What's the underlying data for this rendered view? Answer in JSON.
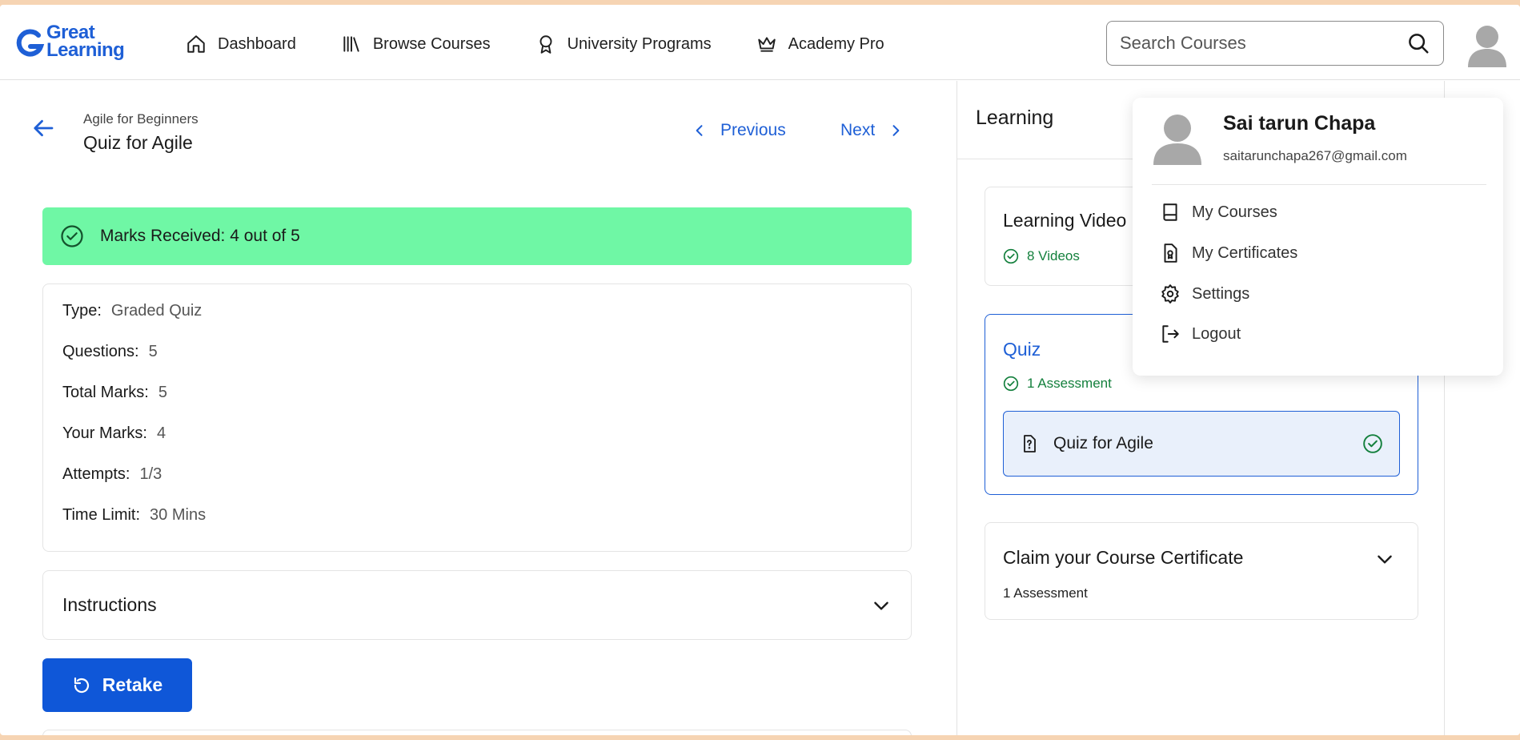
{
  "brand": {
    "line1": "Great",
    "line2": "Learning",
    "color": "#1e5fd6"
  },
  "nav": [
    {
      "label": "Dashboard",
      "icon": "home-icon"
    },
    {
      "label": "Browse Courses",
      "icon": "library-icon"
    },
    {
      "label": "University Programs",
      "icon": "award-icon"
    },
    {
      "label": "Academy Pro",
      "icon": "crown-icon"
    }
  ],
  "search": {
    "placeholder": "Search Courses",
    "icon": "search-icon"
  },
  "page": {
    "breadcrumb": "Agile for Beginners",
    "title": "Quiz for Agile",
    "previous_label": "Previous",
    "next_label": "Next"
  },
  "marks_banner": {
    "text": "Marks Received: 4 out of 5",
    "color": "#6ff7a5"
  },
  "details": [
    {
      "key": "Type:",
      "value": "Graded Quiz"
    },
    {
      "key": "Questions:",
      "value": "5"
    },
    {
      "key": "Total Marks:",
      "value": "5"
    },
    {
      "key": "Your Marks:",
      "value": "4"
    },
    {
      "key": "Attempts:",
      "value": "1/3"
    },
    {
      "key": "Time Limit:",
      "value": "30 Mins"
    }
  ],
  "instructions": {
    "label": "Instructions"
  },
  "retake": {
    "label": "Retake",
    "color": "#0f57d8"
  },
  "sidebar": {
    "title": "Learning",
    "sections": {
      "videos": {
        "title": "Learning Video",
        "subtitle": "8 Videos"
      },
      "quiz": {
        "title": "Quiz",
        "subtitle": "1 Assessment",
        "item": "Quiz for Agile"
      },
      "certificate": {
        "title": "Claim your Course Certificate",
        "subtitle": "1 Assessment"
      }
    }
  },
  "profile_menu": {
    "name": "Sai tarun Chapa",
    "email": "saitarunchapa267@gmail.com",
    "items": [
      {
        "label": "My Courses",
        "icon": "book-icon"
      },
      {
        "label": "My Certificates",
        "icon": "certificate-icon"
      },
      {
        "label": "Settings",
        "icon": "gear-icon"
      },
      {
        "label": "Logout",
        "icon": "logout-icon"
      }
    ]
  }
}
